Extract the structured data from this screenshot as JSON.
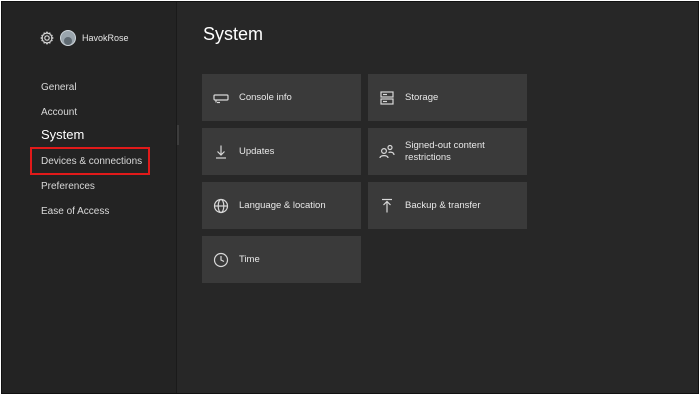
{
  "profile": {
    "gamertag": "HavokRose"
  },
  "sidebar": {
    "items": [
      {
        "label": "General"
      },
      {
        "label": "Account"
      },
      {
        "label": "System"
      },
      {
        "label": "Devices & connections"
      },
      {
        "label": "Preferences"
      },
      {
        "label": "Ease of Access"
      }
    ],
    "active": "System"
  },
  "main": {
    "title": "System",
    "tiles": [
      {
        "label": "Console info",
        "icon": "console-icon"
      },
      {
        "label": "Storage",
        "icon": "storage-icon"
      },
      {
        "label": "Updates",
        "icon": "download-icon"
      },
      {
        "label": "Signed-out content\nrestrictions",
        "icon": "people-restrictions-icon"
      },
      {
        "label": "Language & location",
        "icon": "globe-icon"
      },
      {
        "label": "Backup & transfer",
        "icon": "upload-icon"
      },
      {
        "label": "Time",
        "icon": "clock-icon"
      }
    ]
  },
  "colors": {
    "background": "#272727",
    "sidebar": "#232323",
    "tile": "#3a3a3a",
    "highlight": "#e11a1a"
  }
}
